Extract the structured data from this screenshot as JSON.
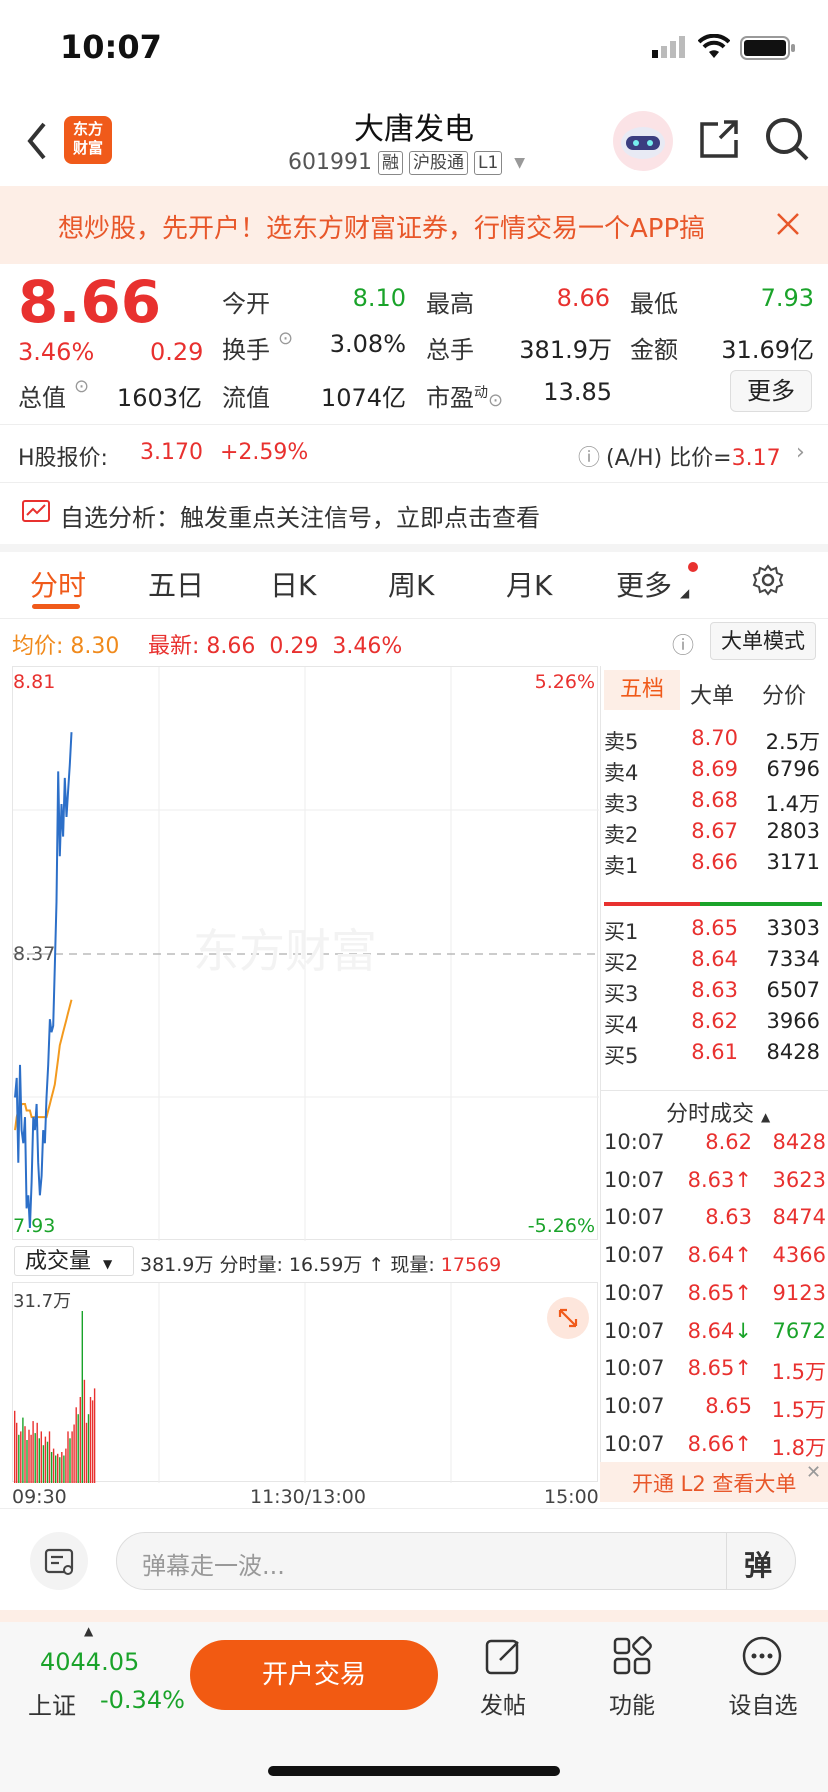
{
  "status_bar": {
    "time": "10:07"
  },
  "header": {
    "logo_text": "东方\n财富",
    "title": "大唐发电",
    "code": "601991",
    "tags": [
      "融",
      "沪股通",
      "L1"
    ]
  },
  "banner": {
    "text": "想炒股，先开户！选东方财富证券，行情交易一个APP搞"
  },
  "quote": {
    "price": "8.66",
    "change_pct": "3.46%",
    "change": "0.29",
    "open_label": "今开",
    "open": "8.10",
    "high_label": "最高",
    "high": "8.66",
    "low_label": "最低",
    "low": "7.93",
    "turnover_label": "换手",
    "turnover": "3.08%",
    "volume_label": "总手",
    "volume": "381.9万",
    "amount_label": "金额",
    "amount": "31.69亿",
    "mktcap_label": "总值",
    "mktcap": "1603亿",
    "float_label": "流值",
    "float": "1074亿",
    "pe_label": "市盈",
    "pe_sup": "动",
    "pe": "13.85",
    "more_button": "更多"
  },
  "hshare": {
    "label": "H股报价:",
    "price": "3.170",
    "change_pct": "+2.59%",
    "ah_label": "(A/H) 比价=",
    "ah_value": "3.17"
  },
  "analysis": {
    "text": "自选分析：触发重点关注信号，立即点击查看"
  },
  "tabs": [
    "分时",
    "五日",
    "日K",
    "周K",
    "月K",
    "更多"
  ],
  "chart_header": {
    "avg_label": "均价:",
    "avg": "8.30",
    "last_label": "最新:",
    "last": "8.66",
    "change": "0.29",
    "change_pct": "3.46%",
    "mode_button": "大单模式"
  },
  "chart_data": {
    "type": "line",
    "y_top_label": "8.81",
    "y_mid_label": "8.37",
    "y_bottom_label": "7.93",
    "pct_top_label": "5.26%",
    "pct_bottom_label": "-5.26%",
    "ylim": [
      7.93,
      8.81
    ],
    "x_labels": [
      "09:30",
      "11:30/13:00",
      "15:00"
    ],
    "price_series": [
      8.15,
      8.18,
      8.05,
      8.2,
      8.1,
      8.08,
      8.12,
      7.98,
      8.0,
      7.95,
      8.02,
      8.12,
      8.1,
      8.14,
      8.05,
      8.0,
      8.03,
      8.1,
      8.08,
      8.15,
      8.2,
      8.27,
      8.25,
      8.26,
      8.35,
      8.45,
      8.65,
      8.52,
      8.6,
      8.55,
      8.64,
      8.58,
      8.62,
      8.66,
      8.71
    ],
    "avg_series": [
      8.1,
      8.12,
      8.13,
      8.13,
      8.14,
      8.14,
      8.14,
      8.13,
      8.13,
      8.13,
      8.12,
      8.12,
      8.12,
      8.12,
      8.12,
      8.12,
      8.12,
      8.12,
      8.12,
      8.12,
      8.13,
      8.14,
      8.15,
      8.16,
      8.17,
      8.19,
      8.21,
      8.23,
      8.24,
      8.25,
      8.26,
      8.27,
      8.28,
      8.29,
      8.3
    ],
    "volume_max_label": "31.7万",
    "volume_series": [
      0.42,
      0.35,
      0.28,
      0.3,
      0.38,
      0.33,
      0.25,
      0.31,
      0.28,
      0.36,
      0.29,
      0.35,
      0.26,
      0.3,
      0.22,
      0.27,
      0.24,
      0.3,
      0.18,
      0.2,
      0.16,
      0.17,
      0.15,
      0.18,
      0.16,
      0.2,
      0.3,
      0.26,
      0.3,
      0.34,
      0.44,
      0.4,
      0.5,
      1.0,
      0.6,
      0.35,
      0.4,
      0.5,
      0.48,
      0.55
    ],
    "volume_colors": [
      "red",
      "red",
      "green",
      "red",
      "green",
      "red",
      "green",
      "red",
      "red",
      "red",
      "green",
      "red",
      "green",
      "red",
      "green",
      "red",
      "green",
      "red",
      "green",
      "red",
      "green",
      "red",
      "green",
      "red",
      "green",
      "red",
      "red",
      "green",
      "red",
      "red",
      "red",
      "green",
      "red",
      "green",
      "red",
      "red",
      "green",
      "red",
      "red",
      "red"
    ]
  },
  "volume_header": {
    "selector": "成交量",
    "total": "381.9万",
    "period_label": "分时量:",
    "period": "16.59万",
    "now_label": "现量:",
    "now": "17569"
  },
  "orderbook": {
    "tabs": [
      "五档",
      "大单",
      "分价"
    ],
    "asks": [
      {
        "side": "卖5",
        "price": "8.70",
        "vol": "2.5万"
      },
      {
        "side": "卖4",
        "price": "8.69",
        "vol": "6796"
      },
      {
        "side": "卖3",
        "price": "8.68",
        "vol": "1.4万"
      },
      {
        "side": "卖2",
        "price": "8.67",
        "vol": "2803"
      },
      {
        "side": "卖1",
        "price": "8.66",
        "vol": "3171"
      }
    ],
    "bids": [
      {
        "side": "买1",
        "price": "8.65",
        "vol": "3303"
      },
      {
        "side": "买2",
        "price": "8.64",
        "vol": "7334"
      },
      {
        "side": "买3",
        "price": "8.63",
        "vol": "6507"
      },
      {
        "side": "买4",
        "price": "8.62",
        "vol": "3966"
      },
      {
        "side": "买5",
        "price": "8.61",
        "vol": "8428"
      }
    ]
  },
  "trades": {
    "title": "分时成交",
    "rows": [
      {
        "time": "10:07",
        "price": "8.62",
        "arrow": "",
        "vol": "8428",
        "vcolor": "red"
      },
      {
        "time": "10:07",
        "price": "8.63",
        "arrow": "↑",
        "vol": "3623",
        "vcolor": "red"
      },
      {
        "time": "10:07",
        "price": "8.63",
        "arrow": "",
        "vol": "8474",
        "vcolor": "red"
      },
      {
        "time": "10:07",
        "price": "8.64",
        "arrow": "↑",
        "vol": "4366",
        "vcolor": "red"
      },
      {
        "time": "10:07",
        "price": "8.65",
        "arrow": "↑",
        "vol": "9123",
        "vcolor": "red"
      },
      {
        "time": "10:07",
        "price": "8.64",
        "arrow": "↓",
        "vol": "7672",
        "vcolor": "green"
      },
      {
        "time": "10:07",
        "price": "8.65",
        "arrow": "↑",
        "vol": "1.5万",
        "vcolor": "red"
      },
      {
        "time": "10:07",
        "price": "8.65",
        "arrow": "",
        "vol": "1.5万",
        "vcolor": "red"
      },
      {
        "time": "10:07",
        "price": "8.66",
        "arrow": "↑",
        "vol": "1.8万",
        "vcolor": "red"
      }
    ],
    "l2_banner": "开通 L2 查看大单"
  },
  "danmu": {
    "placeholder": "弹幕走一波...",
    "send": "弹"
  },
  "bottom": {
    "index_value": "4044.05",
    "index_name": "上证",
    "index_change": "-0.34%",
    "trade_button": "开户交易",
    "nav": [
      "发帖",
      "功能",
      "设自选"
    ]
  },
  "colors": {
    "up": "#e8312f",
    "down": "#1aa32a",
    "accent": "#f05a1a",
    "avg_line": "#f39a1e",
    "price_line": "#2c6fc8"
  }
}
